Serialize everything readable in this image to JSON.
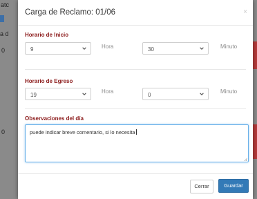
{
  "background": {
    "fragments": [
      "atc",
      "a d",
      "0",
      "0"
    ]
  },
  "modal": {
    "title": "Carga de Reclamo: 01/06",
    "close_glyph": "×",
    "inicio": {
      "label": "Horario de Inicio",
      "hora_value": "9",
      "hora_unit": "Hora",
      "minuto_value": "30",
      "minuto_unit": "Minuto"
    },
    "egreso": {
      "label": "Horario de Egreso",
      "hora_value": "19",
      "hora_unit": "Hora",
      "minuto_value": "0",
      "minuto_unit": "Minuto"
    },
    "observaciones": {
      "label": "Observaciones del día",
      "value": "puede indicar breve comentario, si lo necesita"
    },
    "footer": {
      "cancel_label": "Cerrar",
      "save_label": "Guardar"
    }
  },
  "colors": {
    "label": "#8b1a1a",
    "primary": "#337ab7",
    "focus_border": "#66afe9"
  }
}
